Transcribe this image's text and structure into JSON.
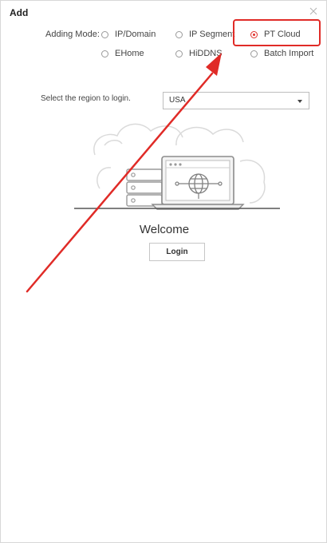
{
  "dialog": {
    "title": "Add"
  },
  "adding_mode": {
    "label": "Adding Mode:",
    "options": [
      {
        "label": "IP/Domain",
        "checked": false
      },
      {
        "label": "IP Segment",
        "checked": false
      },
      {
        "label": "PT Cloud",
        "checked": true
      },
      {
        "label": "EHome",
        "checked": false
      },
      {
        "label": "HiDDNS",
        "checked": false
      },
      {
        "label": "Batch Import",
        "checked": false
      }
    ]
  },
  "region": {
    "label": "Select the region to login.",
    "value": "USA"
  },
  "welcome": "Welcome",
  "login_label": "Login",
  "colors": {
    "accent_red": "#e0302b",
    "annotation_red": "#e02b27"
  },
  "icons": {
    "close": "close-icon",
    "dropdown": "chevron-down-icon",
    "illustration": "cloud-server-laptop-illustration",
    "annotation": "red-arrow-annotation"
  }
}
